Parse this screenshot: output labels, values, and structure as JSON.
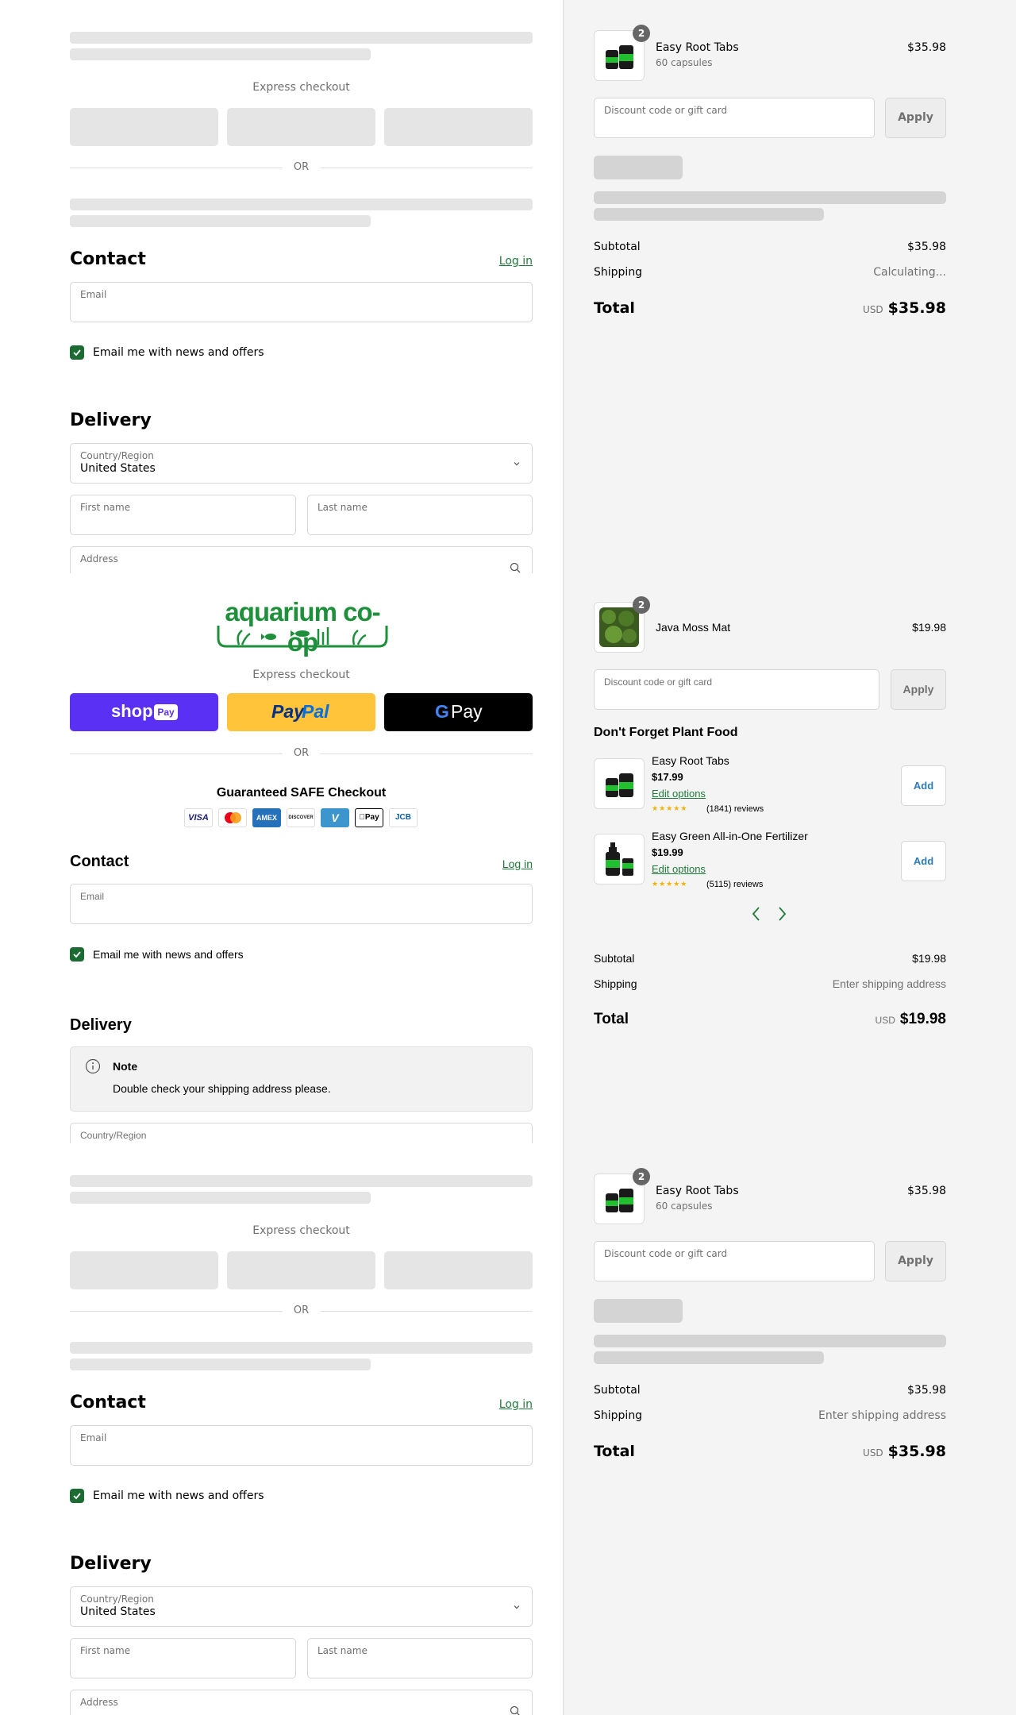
{
  "colors": {
    "accent_green": "#1c6b33",
    "link_green": "#1f7a3a",
    "shop_purple": "#5a31f4",
    "paypal_yellow": "#ffc439",
    "gpay_black": "#000000",
    "add_blue": "#2b7bb9",
    "star_gold": "#f5b100"
  },
  "section1": {
    "express_label": "Express checkout",
    "or_label": "OR",
    "contact": {
      "title": "Contact",
      "login": "Log in",
      "email_label": "Email",
      "newsletter": "Email me with news and offers"
    },
    "delivery": {
      "title": "Delivery",
      "country_label": "Country/Region",
      "country_value": "United States",
      "first_name": "First name",
      "last_name": "Last name",
      "address": "Address"
    },
    "summary": {
      "product": {
        "name": "Easy Root Tabs",
        "variant": "60 capsules",
        "price": "$35.98",
        "qty": "2",
        "icon": "root-tabs-jar-icon"
      },
      "discount_placeholder": "Discount code or gift card",
      "apply": "Apply",
      "subtotal_label": "Subtotal",
      "subtotal": "$35.98",
      "shipping_label": "Shipping",
      "shipping": "Calculating...",
      "total_label": "Total",
      "currency": "USD",
      "total": "$35.98"
    }
  },
  "section2": {
    "logo_text": "aquarium co-op",
    "express_label": "Express checkout",
    "shop_pay": {
      "label": "shop",
      "pay": "Pay"
    },
    "paypal": {
      "pay": "Pay",
      "pal": "Pal"
    },
    "gpay": {
      "g": "G",
      "pay": "Pay"
    },
    "or_label": "OR",
    "safe_checkout": "Guaranteed SAFE Checkout",
    "cards": [
      "VISA",
      "mastercard-icon",
      "AMEX",
      "DISCOVER",
      "V",
      "Pay",
      "JCB"
    ],
    "contact": {
      "title": "Contact",
      "login": "Log in",
      "email_label": "Email",
      "newsletter": "Email me with news and offers"
    },
    "delivery": {
      "title": "Delivery",
      "note_title": "Note",
      "note_text": "Double check your shipping address please.",
      "country_label": "Country/Region"
    },
    "summary": {
      "product": {
        "name": "Java Moss Mat",
        "price": "$19.98",
        "qty": "2",
        "icon": "moss-mat-icon"
      },
      "discount_placeholder": "Discount code or gift card",
      "apply": "Apply",
      "upsell_title": "Don't Forget Plant Food",
      "upsells": [
        {
          "name": "Easy Root Tabs",
          "price": "$17.99",
          "edit": "Edit options",
          "reviews": "(1841) reviews",
          "add": "Add",
          "rating": 5
        },
        {
          "name": "Easy Green All-in-One Fertilizer",
          "price": "$19.99",
          "edit": "Edit options",
          "reviews": "(5115) reviews",
          "add": "Add",
          "rating": 5
        }
      ],
      "subtotal_label": "Subtotal",
      "subtotal": "$19.98",
      "shipping_label": "Shipping",
      "shipping": "Enter shipping address",
      "total_label": "Total",
      "currency": "USD",
      "total": "$19.98"
    }
  },
  "section3": {
    "express_label": "Express checkout",
    "or_label": "OR",
    "contact": {
      "title": "Contact",
      "login": "Log in",
      "email_label": "Email",
      "newsletter": "Email me with news and offers"
    },
    "delivery": {
      "title": "Delivery",
      "country_label": "Country/Region",
      "country_value": "United States",
      "first_name": "First name",
      "last_name": "Last name",
      "address": "Address"
    },
    "summary": {
      "product": {
        "name": "Easy Root Tabs",
        "variant": "60 capsules",
        "price": "$35.98",
        "qty": "2",
        "icon": "root-tabs-jar-icon"
      },
      "discount_placeholder": "Discount code or gift card",
      "apply": "Apply",
      "subtotal_label": "Subtotal",
      "subtotal": "$35.98",
      "shipping_label": "Shipping",
      "shipping": "Enter shipping address",
      "total_label": "Total",
      "currency": "USD",
      "total": "$35.98"
    }
  }
}
